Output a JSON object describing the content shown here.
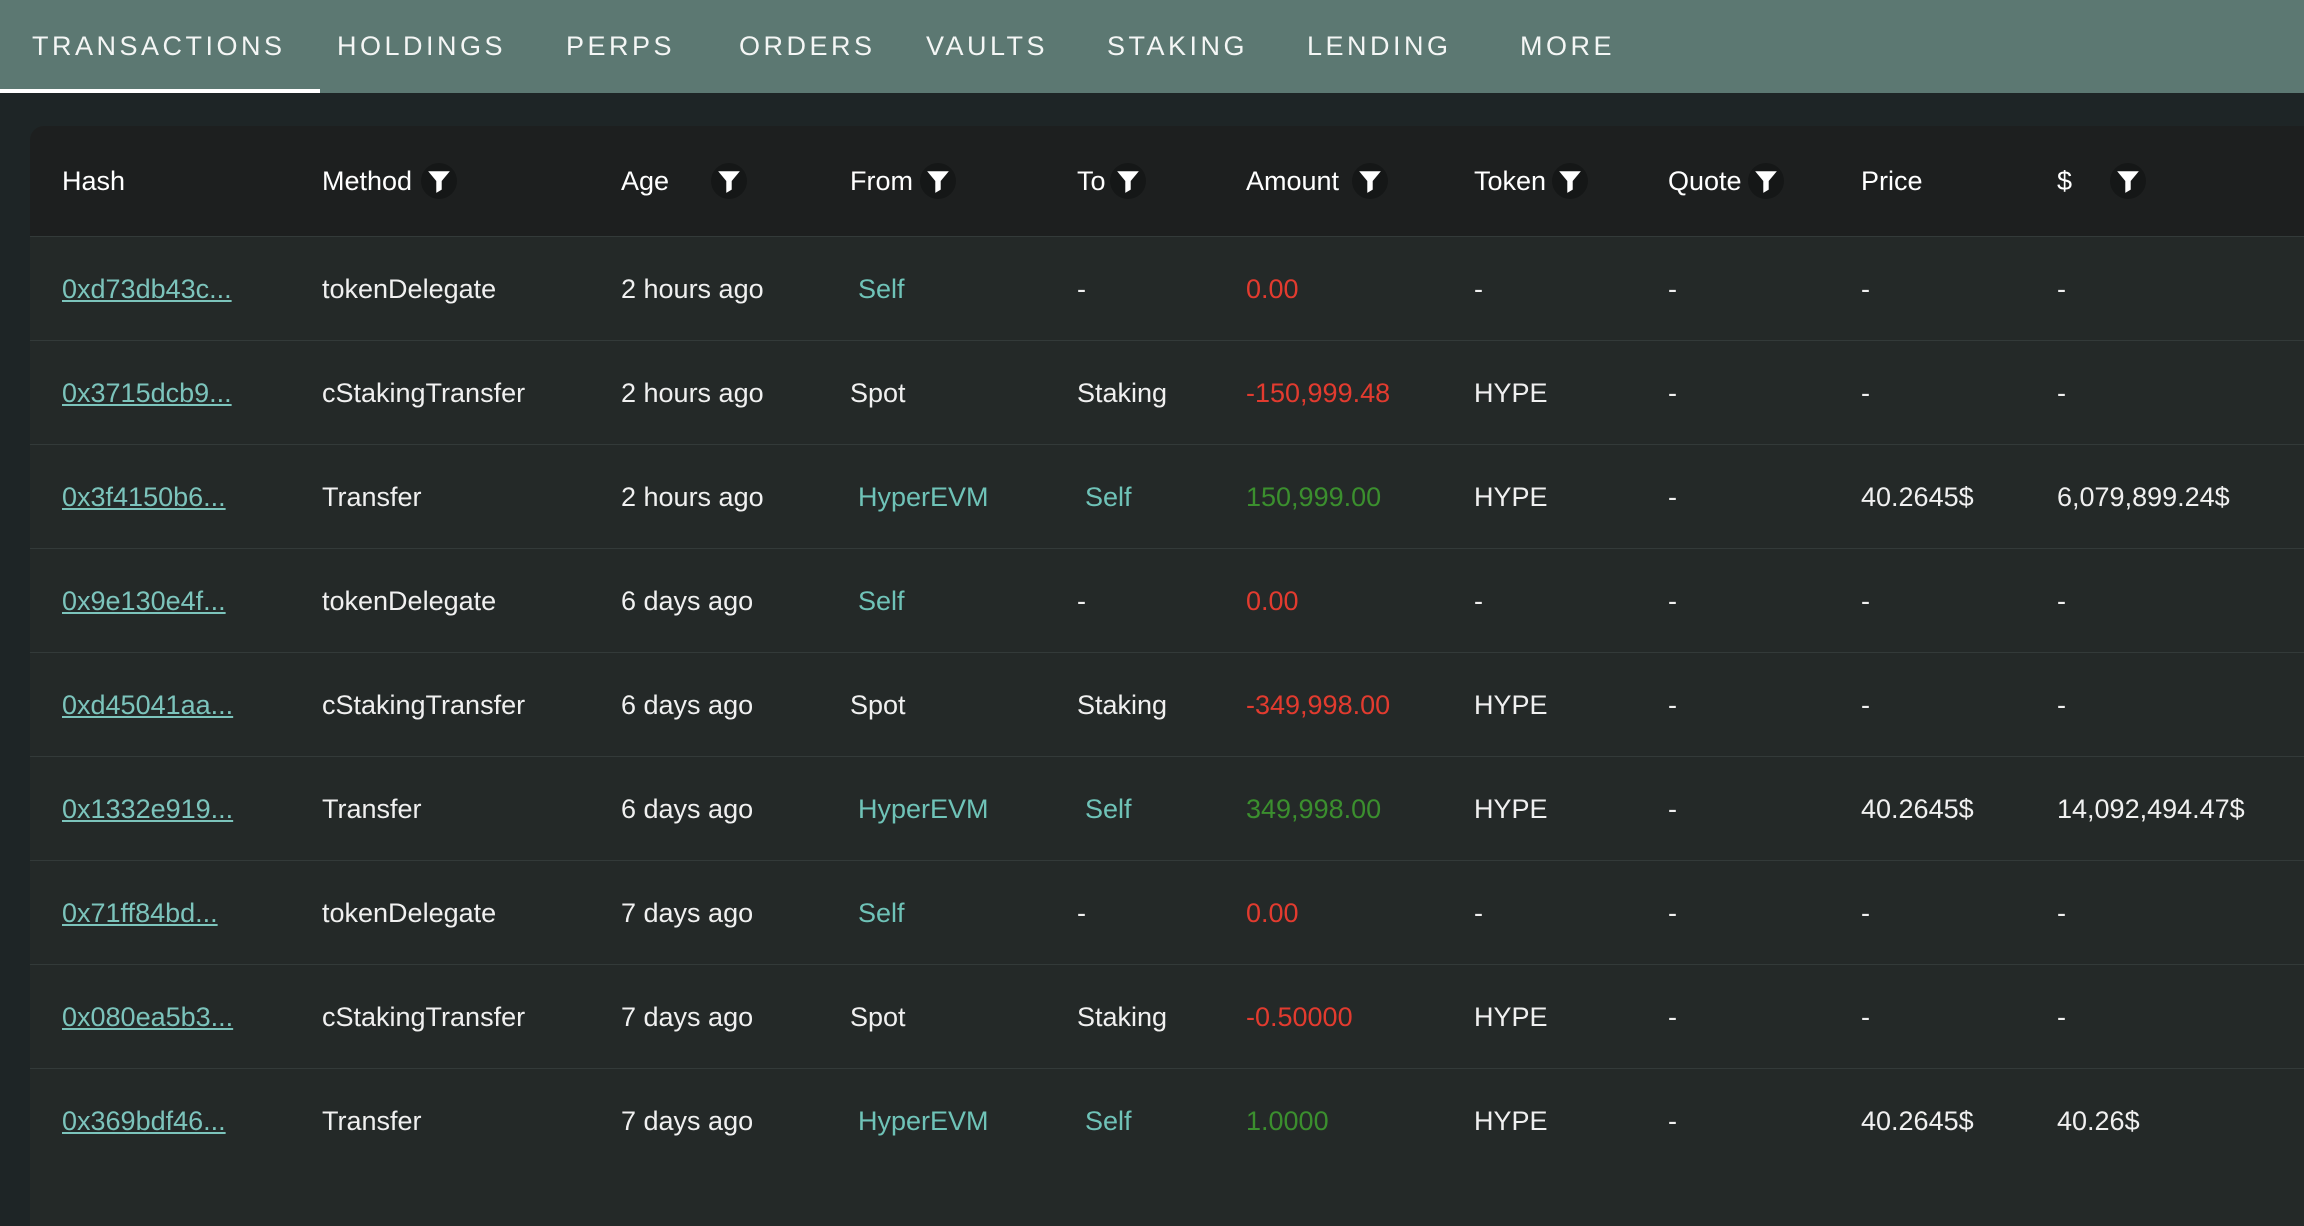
{
  "tabs": [
    {
      "label": "TRANSACTIONS",
      "active": true
    },
    {
      "label": "HOLDINGS"
    },
    {
      "label": "PERPS"
    },
    {
      "label": "ORDERS"
    },
    {
      "label": "VAULTS"
    },
    {
      "label": "STAKING"
    },
    {
      "label": "LENDING"
    },
    {
      "label": "MORE"
    }
  ],
  "table": {
    "columns": [
      "Hash",
      "Method",
      "Age",
      "From",
      "To",
      "Amount",
      "Token",
      "Quote",
      "Price",
      "$"
    ],
    "filterable": [
      "Method",
      "Age",
      "From",
      "To",
      "Amount",
      "Token",
      "Quote",
      "$"
    ],
    "rows": [
      {
        "hash": "0xd73db43c...",
        "method": "tokenDelegate",
        "age": "2 hours ago",
        "from": "Self",
        "to": "-",
        "amount": "0.00",
        "token": "-",
        "quote": "-",
        "price": "-",
        "usd": "-"
      },
      {
        "hash": "0x3715dcb9...",
        "method": "cStakingTransfer",
        "age": "2 hours ago",
        "from": "Spot",
        "to": "Staking",
        "amount": "-150,999.48",
        "token": "HYPE",
        "quote": "-",
        "price": "-",
        "usd": "-"
      },
      {
        "hash": "0x3f4150b6...",
        "method": "Transfer",
        "age": "2 hours ago",
        "from": "HyperEVM",
        "to": "Self",
        "amount": "150,999.00",
        "token": "HYPE",
        "quote": "-",
        "price": "40.2645$",
        "usd": "6,079,899.24$"
      },
      {
        "hash": "0x9e130e4f...",
        "method": "tokenDelegate",
        "age": "6 days ago",
        "from": "Self",
        "to": "-",
        "amount": "0.00",
        "token": "-",
        "quote": "-",
        "price": "-",
        "usd": "-"
      },
      {
        "hash": "0xd45041aa...",
        "method": "cStakingTransfer",
        "age": "6 days ago",
        "from": "Spot",
        "to": "Staking",
        "amount": "-349,998.00",
        "token": "HYPE",
        "quote": "-",
        "price": "-",
        "usd": "-"
      },
      {
        "hash": "0x1332e919...",
        "method": "Transfer",
        "age": "6 days ago",
        "from": "HyperEVM",
        "to": "Self",
        "amount": "349,998.00",
        "token": "HYPE",
        "quote": "-",
        "price": "40.2645$",
        "usd": "14,092,494.47$"
      },
      {
        "hash": "0x71ff84bd...",
        "method": "tokenDelegate",
        "age": "7 days ago",
        "from": "Self",
        "to": "-",
        "amount": "0.00",
        "token": "-",
        "quote": "-",
        "price": "-",
        "usd": "-"
      },
      {
        "hash": "0x080ea5b3...",
        "method": "cStakingTransfer",
        "age": "7 days ago",
        "from": "Spot",
        "to": "Staking",
        "amount": "-0.50000",
        "token": "HYPE",
        "quote": "-",
        "price": "-",
        "usd": "-"
      },
      {
        "hash": "0x369bdf46...",
        "method": "Transfer",
        "age": "7 days ago",
        "from": "HyperEVM",
        "to": "Self",
        "amount": "1.0000",
        "token": "HYPE",
        "quote": "-",
        "price": "40.2645$",
        "usd": "40.26$"
      }
    ]
  },
  "colors": {
    "tab_bar": "#5c7872",
    "page_bg": "#1e2526",
    "link": "#7cc4bc",
    "negative": "#e23b2f",
    "positive": "#3b8f2e"
  },
  "icons": {
    "column_filter": "filter-icon"
  }
}
